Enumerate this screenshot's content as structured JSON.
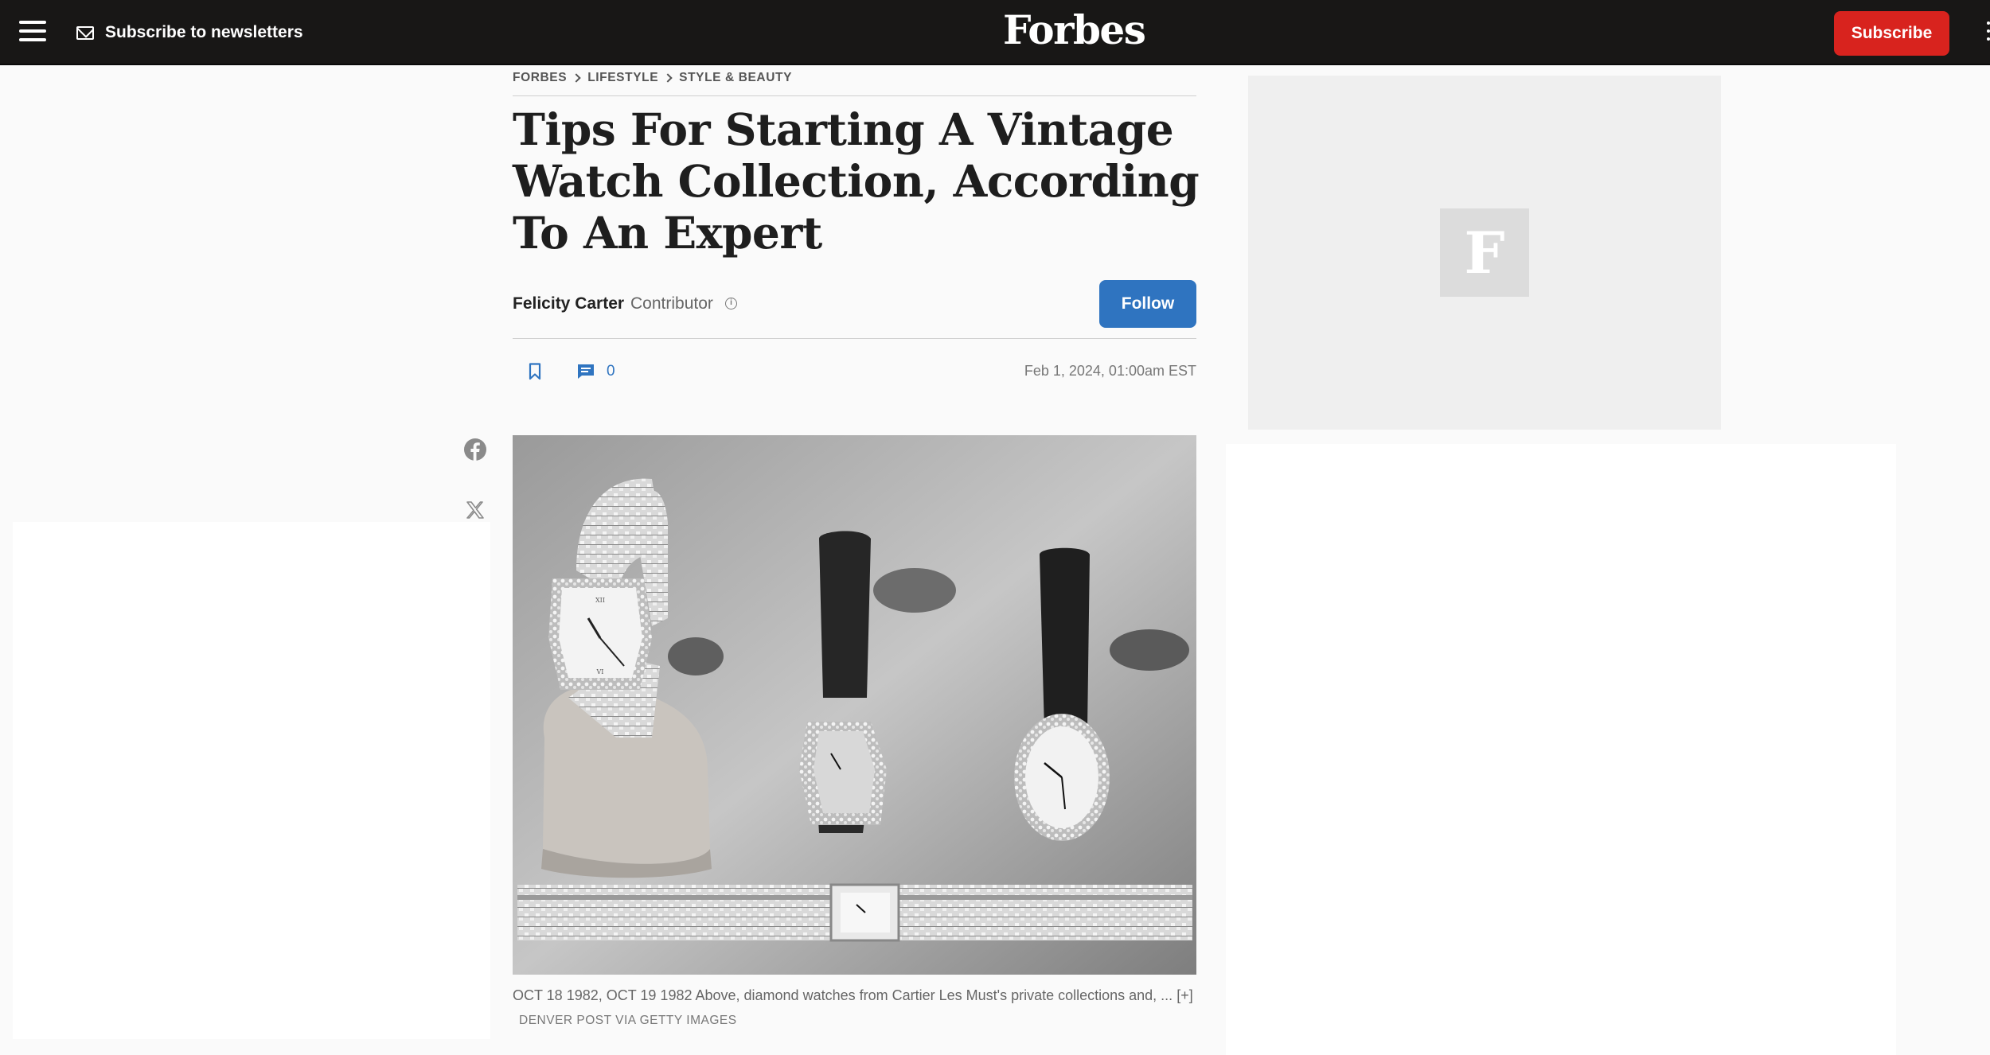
{
  "nav": {
    "newsletter_label": "Subscribe to newsletters",
    "logo_text": "Forbes",
    "subscribe_label": "Subscribe",
    "brand_color": "#181716",
    "accent_color": "#d8231e"
  },
  "breadcrumb": [
    "FORBES",
    "LIFESTYLE",
    "STYLE & BEAUTY"
  ],
  "article": {
    "headline": "Tips For Starting A Vintage Watch Collection, According To An Expert",
    "author": "Felicity Carter",
    "author_role": "Contributor",
    "follow_label": "Follow",
    "comment_count": "0",
    "published": "Feb 1, 2024, 01:00am EST",
    "follow_color": "#2f74c0"
  },
  "share": {
    "icons": [
      "facebook-icon",
      "x-icon"
    ]
  },
  "hero": {
    "caption": "OCT 18 1982, OCT 19 1982 Above, diamond watches from Cartier Les Must's private collections and, ...",
    "expand_label": "[+]",
    "credit": "DENVER POST VIA GETTY IMAGES"
  },
  "ad": {
    "logo_letter": "F"
  }
}
